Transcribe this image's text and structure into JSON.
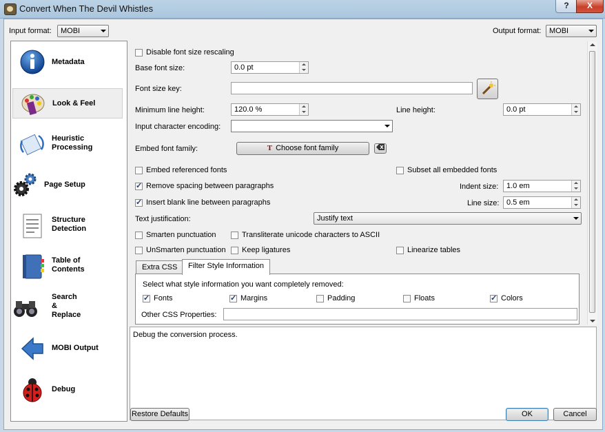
{
  "window": {
    "title": "Convert When The Devil Whistles",
    "help_label": "?",
    "close_label": "X"
  },
  "formats": {
    "input_label": "Input format:",
    "input_value": "MOBI",
    "output_label": "Output format:",
    "output_value": "MOBI"
  },
  "sidebar": {
    "items": [
      {
        "label": "Metadata",
        "icon": "info-icon"
      },
      {
        "label": "Look & Feel",
        "icon": "palette-icon",
        "selected": true
      },
      {
        "label": "Heuristic Processing",
        "icon": "heuristic-icon"
      },
      {
        "label": "Page Setup",
        "icon": "gears-icon"
      },
      {
        "label": "Structure Detection",
        "icon": "document-icon"
      },
      {
        "label": "Table of Contents",
        "icon": "book-icon"
      },
      {
        "label": "Search & Replace",
        "icon": "binoculars-icon"
      },
      {
        "label": "MOBI Output",
        "icon": "arrow-left-icon"
      },
      {
        "label": "Debug",
        "icon": "ladybug-icon"
      }
    ]
  },
  "look_feel": {
    "disable_rescaling": {
      "label": "Disable font size rescaling",
      "checked": false
    },
    "base_font_size": {
      "label": "Base font size:",
      "value": "0.0 pt"
    },
    "font_size_key": {
      "label": "Font size key:",
      "value": ""
    },
    "min_line_height": {
      "label": "Minimum line height:",
      "value": "120.0 %"
    },
    "line_height": {
      "label": "Line height:",
      "value": "0.0 pt"
    },
    "input_encoding": {
      "label": "Input character encoding:",
      "value": ""
    },
    "embed_font_family": {
      "label": "Embed font family:",
      "button": "Choose font family"
    },
    "embed_referenced": {
      "label": "Embed referenced fonts",
      "checked": false
    },
    "subset_embedded": {
      "label": "Subset all embedded fonts",
      "checked": false
    },
    "remove_spacing": {
      "label": "Remove spacing between paragraphs",
      "checked": true
    },
    "indent_size": {
      "label": "Indent size:",
      "value": "1.0 em"
    },
    "insert_blank": {
      "label": "Insert blank line between paragraphs",
      "checked": true
    },
    "line_size": {
      "label": "Line size:",
      "value": "0.5 em"
    },
    "text_justification": {
      "label": "Text justification:",
      "value": "Justify text"
    },
    "smarten": {
      "label": "Smarten punctuation",
      "checked": false
    },
    "transliterate": {
      "label": "Transliterate unicode characters to ASCII",
      "checked": false
    },
    "unsmarten": {
      "label": "UnSmarten punctuation",
      "checked": false
    },
    "keep_ligatures": {
      "label": "Keep ligatures",
      "checked": false
    },
    "linearize": {
      "label": "Linearize tables",
      "checked": false
    }
  },
  "tabs": [
    {
      "label": "Extra CSS",
      "active": false
    },
    {
      "label": "Filter Style Information",
      "active": true
    }
  ],
  "filter": {
    "prompt": "Select what style information you want completely removed:",
    "options": [
      {
        "label": "Fonts",
        "checked": true
      },
      {
        "label": "Margins",
        "checked": true
      },
      {
        "label": "Padding",
        "checked": false
      },
      {
        "label": "Floats",
        "checked": false
      },
      {
        "label": "Colors",
        "checked": true
      }
    ],
    "other_label": "Other CSS Properties:",
    "other_value": ""
  },
  "debug_text": "Debug the conversion process.",
  "footer": {
    "restore": "Restore Defaults",
    "ok": "OK",
    "cancel": "Cancel"
  }
}
